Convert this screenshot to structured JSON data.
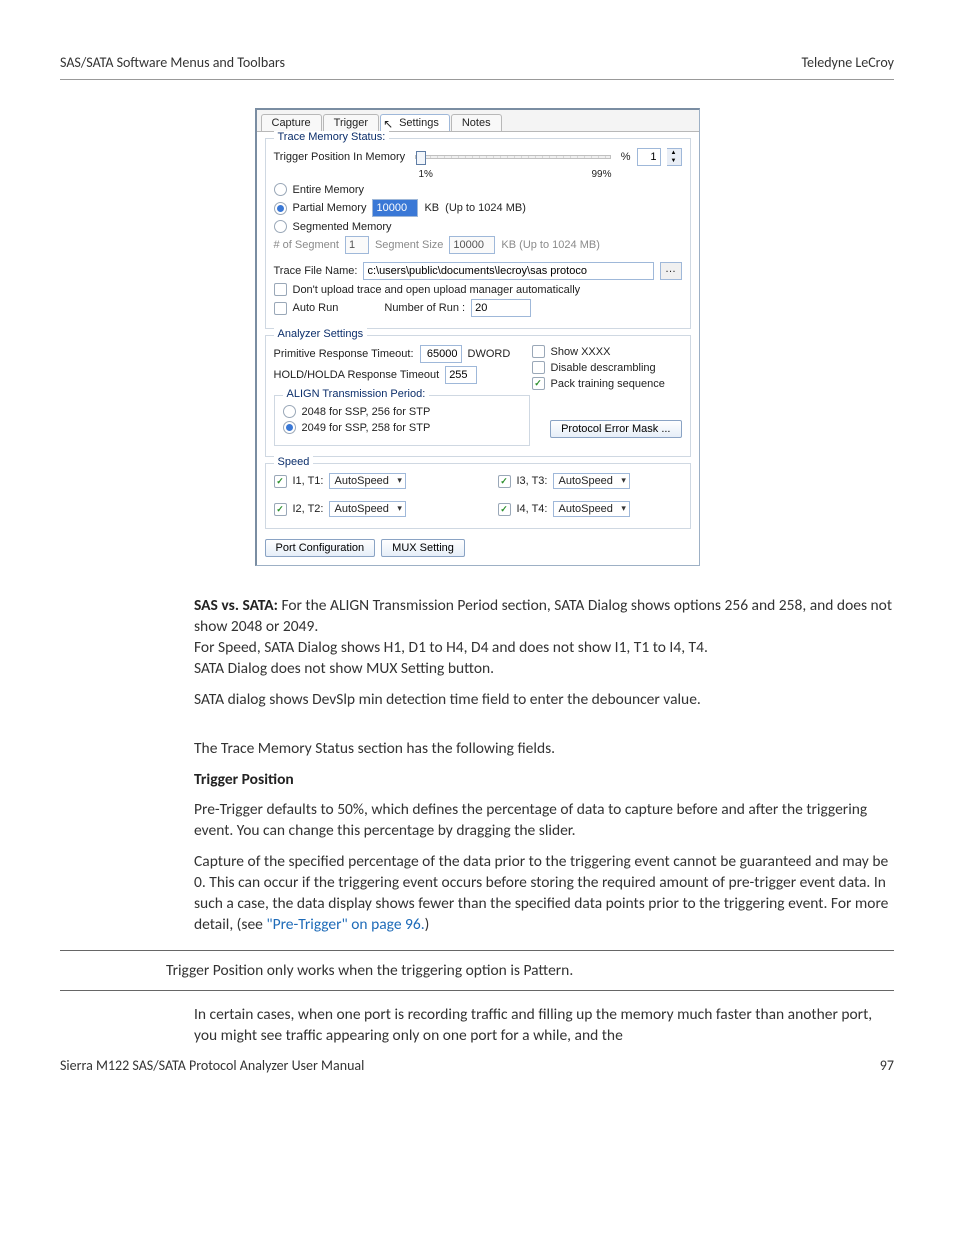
{
  "header": {
    "left": "SAS/SATA Software Menus and Toolbars",
    "right": "Teledyne LeCroy"
  },
  "dialog": {
    "tabs": [
      "Capture",
      "Trigger",
      "Settings",
      "Notes"
    ],
    "active_tab": 2,
    "trace_memory": {
      "legend": "Trace Memory Status:",
      "trigger_pos_label": "Trigger Position In Memory",
      "pct_symbol": "%",
      "pct_value": "1",
      "low": "1%",
      "high": "99%",
      "entire": "Entire Memory",
      "partial": "Partial Memory",
      "partial_value": "10000",
      "kb_label": "KB",
      "kb_hint": "(Up to 1024 MB)",
      "segmented": "Segmented Memory",
      "seg_count_label": "# of Segment",
      "seg_count": "1",
      "seg_size_label": "Segment Size",
      "seg_size": "10000",
      "seg_hint": "KB  (Up to 1024 MB)",
      "trace_file_label": "Trace File Name:",
      "trace_file_value": "c:\\users\\public\\documents\\lecroy\\sas protoco",
      "no_upload": "Don't upload trace and open upload manager automatically",
      "auto_run": "Auto Run",
      "num_run_label": "Number of Run :",
      "num_run": "20"
    },
    "analyzer": {
      "legend": "Analyzer Settings",
      "prim_timeout_label": "Primitive Response Timeout:",
      "prim_timeout": "65000",
      "dword": "DWORD",
      "show_xxxx": "Show XXXX",
      "holda_label": "HOLD/HOLDA Response Timeout",
      "holda_value": "255",
      "disable_descr": "Disable descrambling",
      "pack_train": "Pack training sequence",
      "align_legend": "ALIGN Transmission Period:",
      "align_opt1": "2048 for SSP, 256 for STP",
      "align_opt2": "2049 for SSP, 258 for STP",
      "proto_err_btn": "Protocol Error Mask ..."
    },
    "speed": {
      "legend": "Speed",
      "i1": "I1, T1:",
      "i2": "I2, T2:",
      "i3": "I3, T3:",
      "i4": "I4, T4:",
      "value": "AutoSpeed"
    },
    "port_cfg_btn": "Port Configuration",
    "mux_btn": "MUX Setting"
  },
  "body": {
    "sas_sata_lead": "SAS vs. SATA: ",
    "p1a": "For the ALIGN Transmission Period section, SATA Dialog shows options 256 and 258, and does not show 2048 or 2049.",
    "p1b": "For Speed, SATA Dialog shows H1, D1 to H4, D4 and does not show I1, T1 to I4, T4.",
    "p1c": "SATA Dialog does not show MUX Setting button.",
    "p2": "SATA dialog shows DevSlp min detection time field to enter the debouncer value.",
    "p3": "The Trace Memory Status section has the following fields.",
    "h_trigger": "Trigger Position",
    "p4": "Pre-Trigger defaults to 50%, which defines the percentage of data to capture before and after the triggering event. You can change this percentage by dragging the slider.",
    "p5a": "Capture of the specified percentage of the data prior to the triggering event cannot be guaranteed and may be 0. This can occur if the triggering event occurs before storing the required amount of pre-trigger event data. In such a case, the data display shows fewer than the specified data points prior to the triggering event. For more detail, (see ",
    "p5_link": "\"Pre-Trigger\" on page 96.",
    "p5b": ")",
    "note": "Trigger Position only works when the triggering option is Pattern.",
    "p6": "In certain cases, when one port is recording traffic and filling up the memory much faster than another port, you might see traffic appearing only on one port for a while, and the"
  },
  "footer": {
    "left": "Sierra M122 SAS/SATA Protocol Analyzer User Manual",
    "right": "97"
  }
}
